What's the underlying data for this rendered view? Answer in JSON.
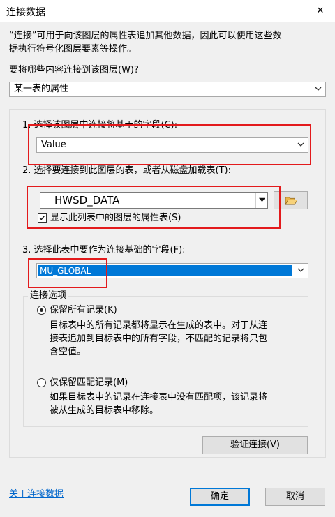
{
  "window": {
    "title": "连接数据",
    "close_glyph": "✕"
  },
  "intro": {
    "line1": "“连接”可用于向该图层的属性表追加其他数据，因此可以使用这些数",
    "line2": "据执行符号化图层要素等操作。"
  },
  "join_what": {
    "label": "要将哪些内容连接到该图层(W)?",
    "selected": "某一表的属性"
  },
  "step1": {
    "label": "1. 选择该图层中连接将基于的字段(C):",
    "selected": "Value"
  },
  "step2": {
    "label": "2. 选择要连接到此图层的表，或者从磁盘加载表(T):",
    "selected": "HWSD_DATA",
    "browse_icon": "folder-open-icon",
    "checkbox_checked": true,
    "checkbox_label": "显示此列表中的图层的属性表(S)"
  },
  "step3": {
    "label": "3. 选择此表中要作为连接基础的字段(F):",
    "selected": "MU_GLOBAL"
  },
  "join_options": {
    "title": "连接选项",
    "keep_all": {
      "label": "保留所有记录(K)",
      "selected": true,
      "desc1": "目标表中的所有记录都将显示在生成的表中。对于从连",
      "desc2": "接表追加到目标表中的所有字段，不匹配的记录将只包",
      "desc3": "含空值。"
    },
    "keep_matching": {
      "label": "仅保留匹配记录(M)",
      "selected": false,
      "desc1": "如果目标表中的记录在连接表中没有匹配项，该记录将",
      "desc2": "被从生成的目标表中移除。"
    }
  },
  "buttons": {
    "validate": "验证连接(V)",
    "ok": "确定",
    "cancel": "取消"
  },
  "about_link": "关于连接数据",
  "colors": {
    "highlight": "#0078d7",
    "annotation_red": "#e31a1c",
    "link": "#0066cc",
    "dialog_bg": "#f0f0f0"
  }
}
